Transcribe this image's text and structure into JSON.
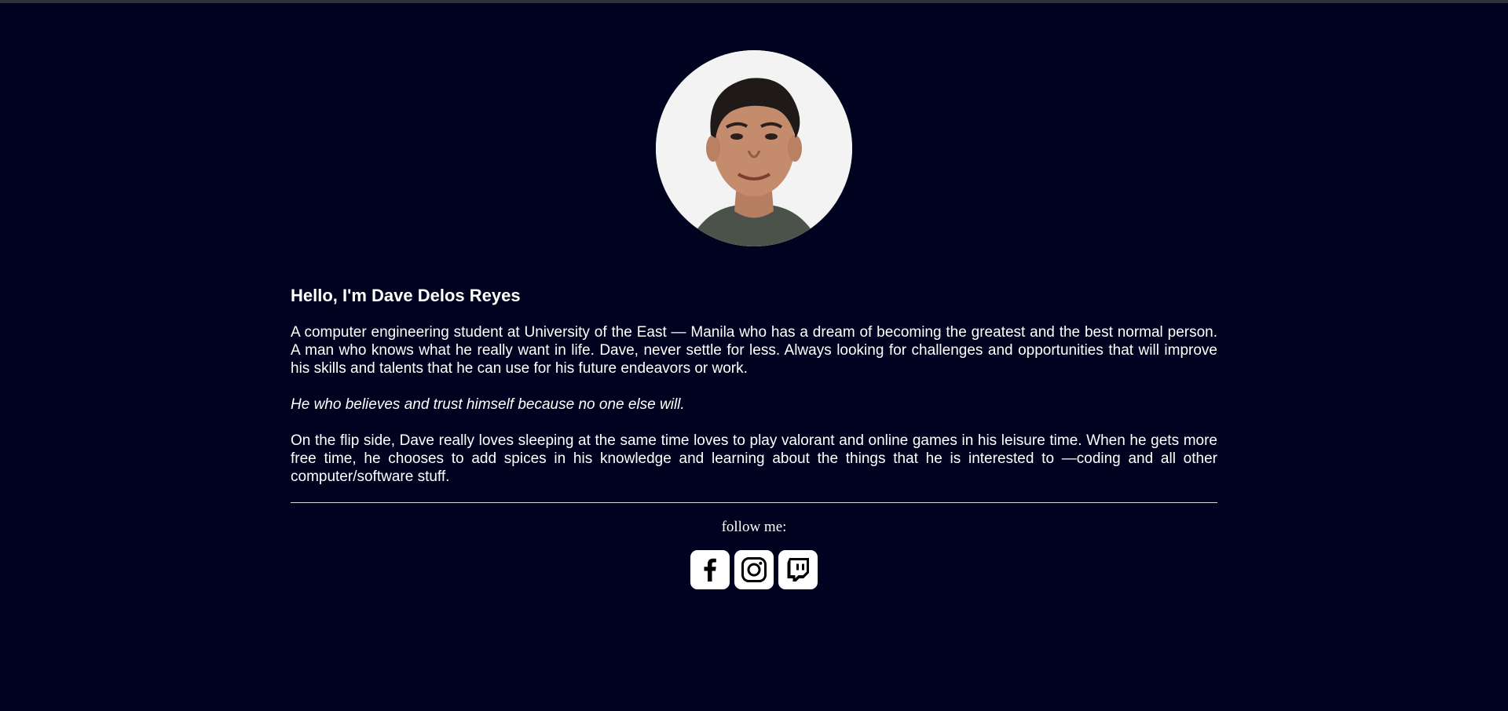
{
  "profile": {
    "avatar_alt": "Dave Delos Reyes portrait"
  },
  "about": {
    "greeting": "Hello, I'm Dave Delos Reyes",
    "intro": "A computer engineering student at University of the East — Manila who has a dream of becoming the greatest and the best normal person. A man who knows what he really want in life. Dave, never settle for less. Always looking for challenges and opportunities that will improve his skills and talents that he can use for his future endeavors or work.",
    "quote": "He who believes and trust himself because no one else will.",
    "flip_side": "On the flip side, Dave really loves sleeping at the same time loves to play valorant and online games in his leisure time. When he gets more free time, he chooses to add spices in his knowledge and learning about the things that he is interested to —coding and all other computer/software stuff."
  },
  "footer": {
    "follow_label": "follow me:",
    "socials": [
      {
        "icon": "facebook-icon"
      },
      {
        "icon": "instagram-icon"
      },
      {
        "icon": "twitch-icon"
      }
    ]
  },
  "colors": {
    "background": "#00031f",
    "text": "#ffffff",
    "icon_bg": "#ffffff",
    "icon_fg": "#000000"
  }
}
